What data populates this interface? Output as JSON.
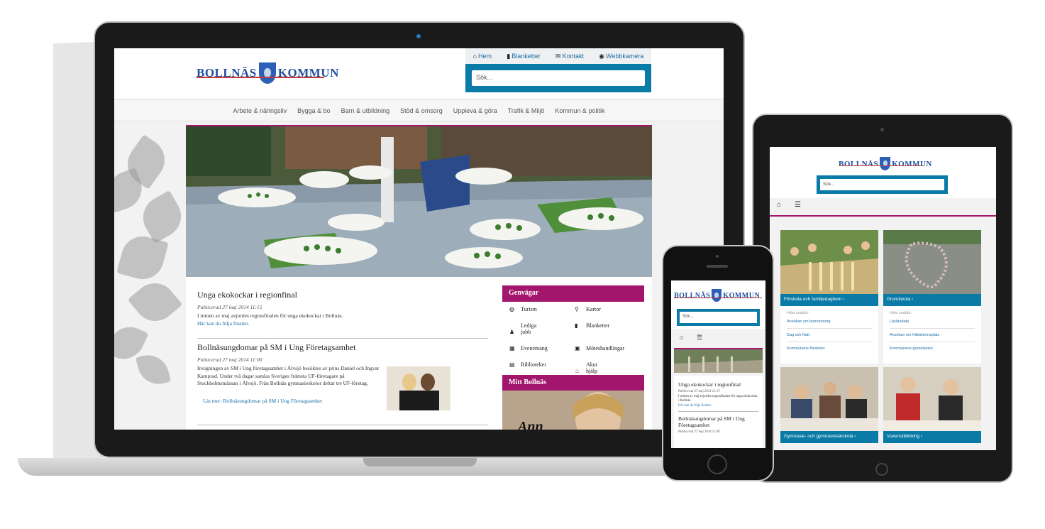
{
  "site": {
    "logo_left": "BOLLNÄS",
    "logo_right": "KOMMUN"
  },
  "desktop": {
    "top_nav": [
      {
        "icon": "home-icon",
        "label": "Hem"
      },
      {
        "icon": "document-icon",
        "label": "Blanketter"
      },
      {
        "icon": "envelope-icon",
        "label": "Kontakt"
      },
      {
        "icon": "camera-icon",
        "label": "Webbkamera"
      }
    ],
    "search_placeholder": "Sök...",
    "main_nav": [
      "Arbete & näringsliv",
      "Bygga & bo",
      "Barn & utbildning",
      "Stöd & omsorg",
      "Uppleva & göra",
      "Trafik & Miljö",
      "Kommun & politik"
    ],
    "news": [
      {
        "title": "Unga ekokockar i regionfinal",
        "date": "Publicerad 27 maj 2014 11:15",
        "text": "I mitten av maj avjordes regionfinalen för unga ekokockar i Bollnäs.",
        "link": "Här kan du följa finalen."
      },
      {
        "title": "Bollnäsungdomar på SM i Ung Företagsamhet",
        "date": "Publicerad 27 maj 2014 11:00",
        "text": "Invigningen av SM i Ung företagsamhet i Älvsjö besöktes av prins Daniel och Ingvar Kamprad. Under två dagar samlas Sveriges främsta UF-företagare på Stockholmsmässan i Älvsjö. Från Bollnäs gymnasieskolor deltar tre UF-företag.",
        "link": "Läs mer: Bollnäsungdomar på SM i Ung Företagsamhet"
      }
    ],
    "genvagar": {
      "title": "Genvägar",
      "items": [
        {
          "icon": "globe-icon",
          "label": "Turism"
        },
        {
          "icon": "map-pin-icon",
          "label": "Kartor"
        },
        {
          "icon": "person-icon",
          "label": "Lediga jobb"
        },
        {
          "icon": "document-icon",
          "label": "Blanketter"
        },
        {
          "icon": "calendar-icon",
          "label": "Evenemang"
        },
        {
          "icon": "briefcase-icon",
          "label": "Möteshandlingar"
        },
        {
          "icon": "book-icon",
          "label": "Biblioteket"
        },
        {
          "icon": "fire-icon",
          "label": "Akut hjälp"
        }
      ]
    },
    "mitt_title": "Mitt Bollnäs",
    "mitt_caption": "Ann"
  },
  "tablet": {
    "search_placeholder": "Sök...",
    "tiles": [
      {
        "caption": "Förskola och familjedaghem ›",
        "sub": "Hitta snabbt:",
        "links": [
          "Ansökan om barnomsorg",
          "Dag och Natt",
          "Kommunens förskolor"
        ]
      },
      {
        "caption": "Grundskola ›",
        "sub": "Hitta snabbt:",
        "links": [
          "Läsårsdata",
          "Ansökan om fritidshemsplats",
          "Kommunens grundskolor"
        ]
      },
      {
        "caption": "Gymnasie- och gymnasiesärskola ›"
      },
      {
        "caption": "Vuxenutbildning ›"
      }
    ]
  },
  "phone": {
    "search_placeholder": "Sök...",
    "news": [
      {
        "title": "Unga ekokockar i regionfinal",
        "date": "Publicerad 27 maj 2014 11:15",
        "text": "I mitten av maj avjordes regionfinalen för unga ekokockar i Bollnäs.",
        "link": "Här kan du följa finalen."
      },
      {
        "title": "Bollnäsungdomar på SM i Ung Företagsamhet",
        "date": "Publicerad 27 maj 2014 11:00"
      }
    ]
  },
  "colors": {
    "accent": "#a3166d",
    "search_bar": "#0a7aa6",
    "link": "#1a6ea8"
  }
}
